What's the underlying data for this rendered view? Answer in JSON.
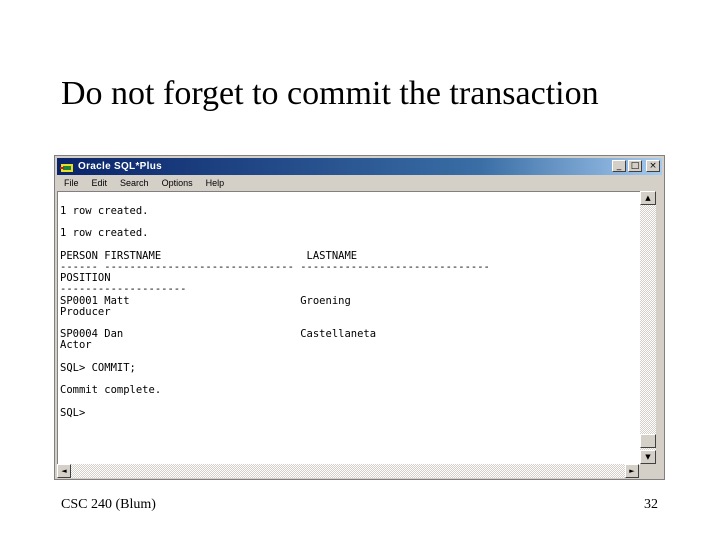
{
  "slide": {
    "title": "Do not forget to commit the transaction",
    "footer_left": "CSC 240 (Blum)",
    "page_number": "32"
  },
  "window": {
    "title": "Oracle SQL*Plus",
    "buttons": {
      "minimize": "_",
      "maximize": "□",
      "close": "×"
    }
  },
  "menu": {
    "file": "File",
    "edit": "Edit",
    "search": "Search",
    "options": "Options",
    "help": "Help"
  },
  "console": {
    "text": "1 row created.\n\n1 row created.\n\nPERSON FIRSTNAME                       LASTNAME\n------ ------------------------------ ------------------------------\nPOSITION\n--------------------\nSP0001 Matt                           Groening\nProducer\n\nSP0004 Dan                            Castellaneta\nActor\n\nSQL> COMMIT;\n\nCommit complete.\n\nSQL>"
  },
  "scroll": {
    "up": "▲",
    "down": "▼",
    "left": "◄",
    "right": "►"
  },
  "colors": {
    "titlebar_start": "#0a246a",
    "titlebar_end": "#a6caf0",
    "window_face": "#d4d0c8"
  }
}
